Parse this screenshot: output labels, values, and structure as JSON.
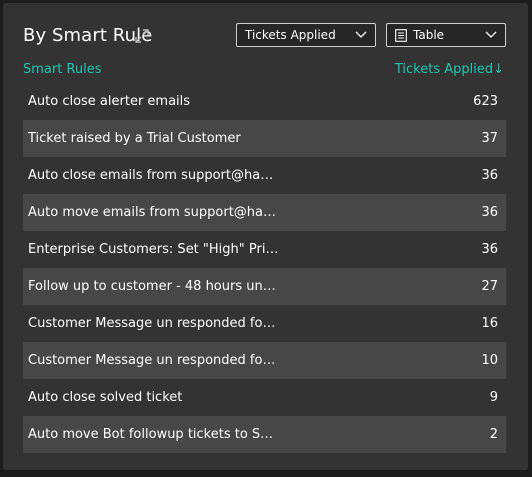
{
  "widget": {
    "title": "By Smart Rule",
    "expand_icon": "expand-arrows-icon",
    "metric_dropdown": {
      "value": "Tickets Applied"
    },
    "view_dropdown": {
      "value": "Table",
      "icon": "table-icon"
    }
  },
  "table": {
    "col_rule": "Smart Rules",
    "col_count": "Tickets Applied↓",
    "rows": [
      {
        "name": "Auto close alerter emails",
        "count": "623"
      },
      {
        "name": "Ticket raised by a Trial Customer",
        "count": "37"
      },
      {
        "name": "Auto close emails from support@ha…",
        "count": "36"
      },
      {
        "name": "Auto move emails from support@ha…",
        "count": "36"
      },
      {
        "name": "Enterprise Customers: Set \"High\" Pri…",
        "count": "36"
      },
      {
        "name": "Follow up to customer - 48 hours un…",
        "count": "27"
      },
      {
        "name": "Customer Message un responded fo…",
        "count": "16"
      },
      {
        "name": "Customer Message un responded fo…",
        "count": "10"
      },
      {
        "name": "Auto close solved ticket",
        "count": "9"
      },
      {
        "name": "Auto move Bot followup tickets to S…",
        "count": "2"
      }
    ]
  },
  "colors": {
    "panel_bg": "#333333",
    "row_alt_bg": "#474747",
    "accent": "#1fc7b0",
    "text": "#ffffff"
  }
}
